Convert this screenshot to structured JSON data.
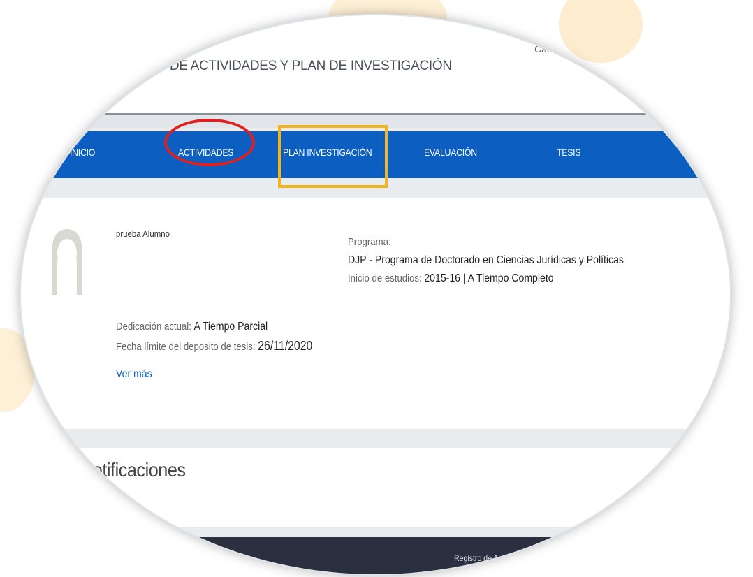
{
  "header": {
    "title": "RO DE ACTIVIDADES Y PLAN DE INVESTIGACIÓN",
    "cambiar": "Cambia"
  },
  "nav": {
    "items": [
      {
        "label": "INICIO"
      },
      {
        "label": "ACTIVIDADES"
      },
      {
        "label": "PLAN INVESTIGACIÓN"
      },
      {
        "label": "EVALUACIÓN"
      },
      {
        "label": "TESIS"
      }
    ]
  },
  "annotations": {
    "circle_color": "#e02020",
    "box_color": "#f3b41b"
  },
  "profile": {
    "name": "prueba Alumno",
    "programa_label": "Programa:",
    "programa_value": "DJP - Programa de Doctorado en Ciencias Jurídicas y Políticas",
    "inicio_label": "Inicio de estudios:",
    "inicio_value": "2015-16 | A Tiempo Completo",
    "dedicacion_label": "Dedicación actual:",
    "dedicacion_value": "A Tiempo Parcial",
    "fecha_label": "Fecha límite del deposito de tesis:",
    "fecha_value": "26/11/2020",
    "ver_mas": "Ver más"
  },
  "notifications": {
    "title": "Notificaciones"
  },
  "footer": {
    "text": "Registro de Activid"
  },
  "colors": {
    "nav_bg": "#0c5ec0",
    "footer_bg": "#2b3040"
  }
}
